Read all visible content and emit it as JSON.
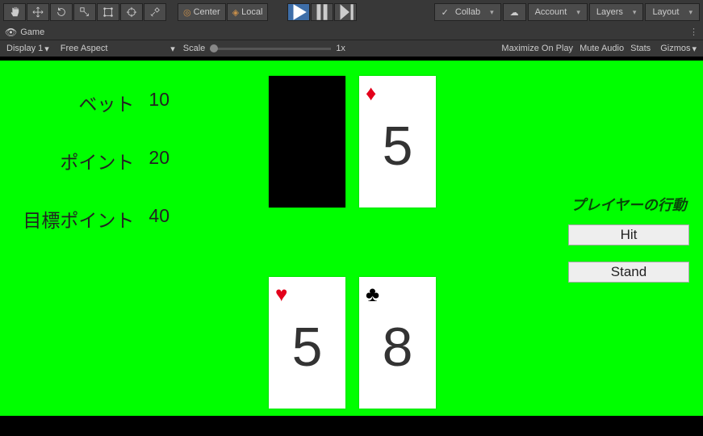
{
  "toolbar": {
    "pivot_center": "Center",
    "pivot_local": "Local",
    "collab": "Collab",
    "account": "Account",
    "layers": "Layers",
    "layout": "Layout"
  },
  "tabs": {
    "game": "Game"
  },
  "controls": {
    "display": "Display 1",
    "aspect": "Free Aspect",
    "scale_label": "Scale",
    "scale_value": "1x",
    "maximize": "Maximize On Play",
    "mute": "Mute Audio",
    "stats": "Stats",
    "gizmos": "Gizmos"
  },
  "game": {
    "stats": {
      "bet_label": "ベット",
      "bet_value": "10",
      "point_label": "ポイント",
      "point_value": "20",
      "target_label": "目標ポイント",
      "target_value": "40"
    },
    "dealer_cards": [
      {
        "hidden": true
      },
      {
        "suit": "diamond",
        "value": "5"
      }
    ],
    "player_cards": [
      {
        "suit": "heart",
        "value": "5"
      },
      {
        "suit": "club",
        "value": "8"
      }
    ],
    "action": {
      "title": "プレイヤーの行動",
      "hit": "Hit",
      "stand": "Stand"
    }
  }
}
